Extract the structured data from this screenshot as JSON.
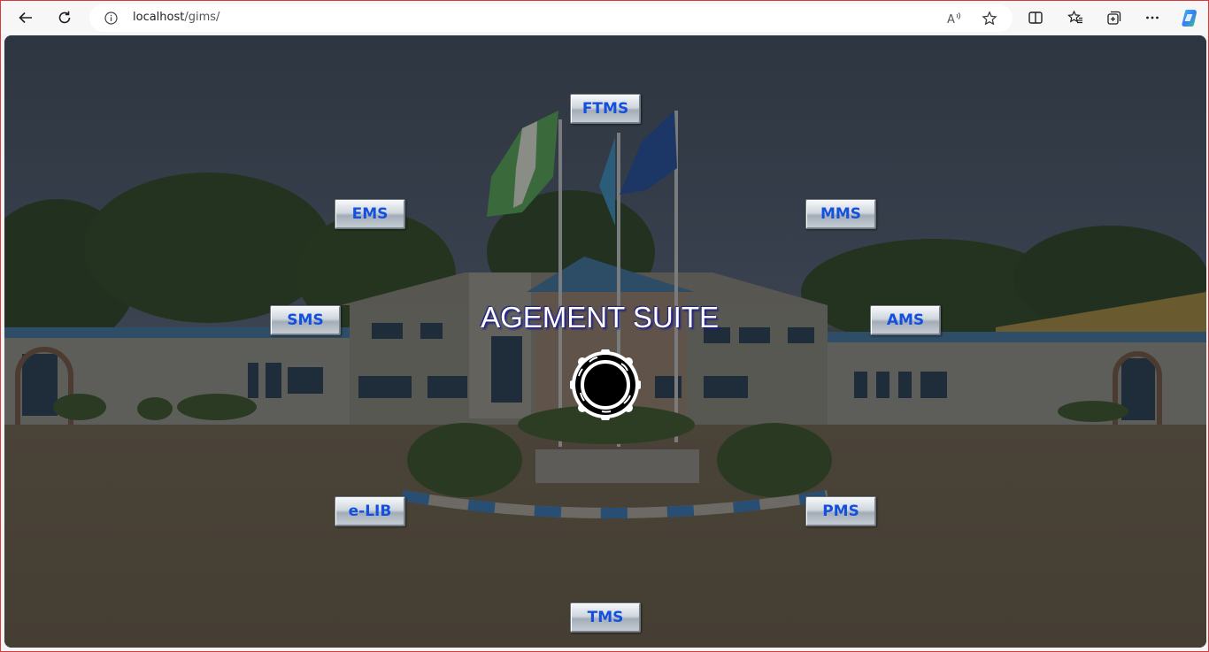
{
  "browser": {
    "url_host": "localhost",
    "url_path": "/gims/",
    "icons": {
      "back": "back-arrow-icon",
      "refresh": "refresh-icon",
      "info": "info-icon",
      "read_aloud": "read-aloud-icon",
      "favorite": "star-icon",
      "split_screen": "split-screen-icon",
      "favorites": "favorites-icon",
      "collections": "collections-icon",
      "more": "more-icon",
      "copilot": "copilot-icon"
    }
  },
  "page": {
    "title_visible": "AGEMENT SUITE",
    "loading_indicator": "spinner-icon",
    "modules": {
      "top": "FTMS",
      "top_left": "EMS",
      "top_right": "MMS",
      "left": "SMS",
      "right": "AMS",
      "bottom_left": "e-LIB",
      "bottom_right": "PMS",
      "bottom": "TMS"
    },
    "colors": {
      "module_text": "#1450e0",
      "title_text": "#ffffff",
      "title_shadow": "#1a1a8a"
    }
  }
}
